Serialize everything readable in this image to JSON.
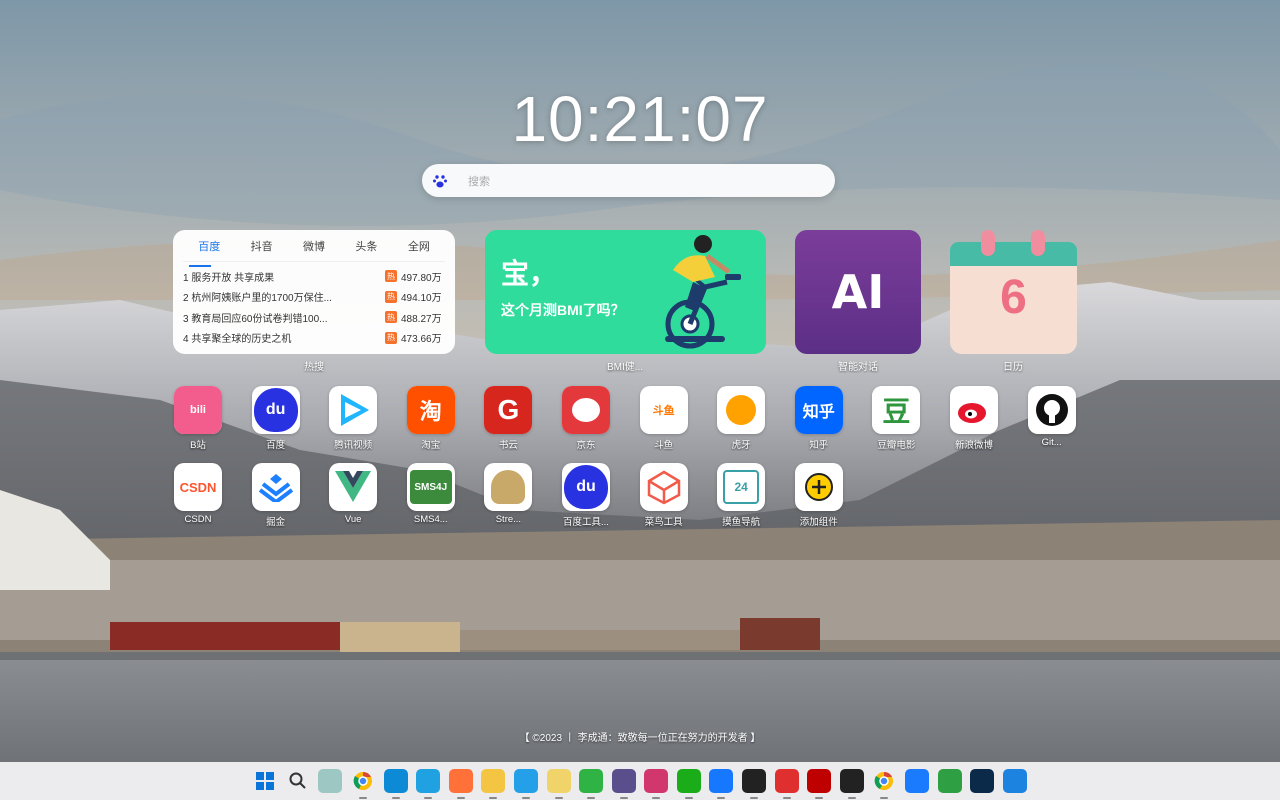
{
  "clock": {
    "time": "10:21:07"
  },
  "search": {
    "placeholder": "搜索",
    "engine_icon": "baidu-paw-icon"
  },
  "hot_widget": {
    "tabs": [
      "百度",
      "抖音",
      "微博",
      "头条",
      "全网"
    ],
    "active_tab": 0,
    "badge": "热",
    "items": [
      {
        "title": "1 服务开放 共享成果",
        "count": "497.80万"
      },
      {
        "title": "2 杭州阿姨账户里的1700万保住...",
        "count": "494.10万"
      },
      {
        "title": "3 教育局回应60份试卷判错100...",
        "count": "488.27万"
      },
      {
        "title": "4 共享聚全球的历史之机",
        "count": "473.66万"
      }
    ],
    "label": "热搜"
  },
  "bmi_widget": {
    "line1": "宝，",
    "line2": "这个月测BMI了吗？",
    "label": "BMI健..."
  },
  "ai_widget": {
    "text": "AI",
    "label": "智能对话"
  },
  "calendar_widget": {
    "day": "6",
    "label": "日历"
  },
  "apps_row1": [
    {
      "label": "B站",
      "icon": "bilibili-icon",
      "color": "#f25d8e"
    },
    {
      "label": "百度",
      "icon": "baidu-icon",
      "color": "#2932e1"
    },
    {
      "label": "腾讯视频",
      "icon": "tencent-video-icon",
      "color": "#1fb5ff"
    },
    {
      "label": "淘宝",
      "icon": "taobao-icon",
      "color": "#ff5000"
    },
    {
      "label": "书云",
      "icon": "g-logo-icon",
      "color": "#d7261e"
    },
    {
      "label": "京东",
      "icon": "jd-dog-icon",
      "color": "#e4393c"
    },
    {
      "label": "斗鱼",
      "icon": "douyu-icon",
      "color": "#ff7700"
    },
    {
      "label": "虎牙",
      "icon": "huya-icon",
      "color": "#ffa200"
    },
    {
      "label": "知乎",
      "icon": "zhihu-icon",
      "color": "#0066ff"
    },
    {
      "label": "豆瓣电影",
      "icon": "douban-icon",
      "color": "#2e963d"
    },
    {
      "label": "新浪微博",
      "icon": "weibo-icon",
      "color": "#e6162d"
    },
    {
      "label": "Git...",
      "icon": "github-icon",
      "color": "#000000"
    }
  ],
  "apps_row2": [
    {
      "label": "CSDN",
      "icon": "csdn-icon",
      "color": "#fc5531"
    },
    {
      "label": "掘金",
      "icon": "juejin-icon",
      "color": "#1e80ff"
    },
    {
      "label": "Vue",
      "icon": "vue-icon",
      "color": "#41b883"
    },
    {
      "label": "SMS4...",
      "icon": "sms4j-icon",
      "color": "#3c8a3c"
    },
    {
      "label": "Stre...",
      "icon": "streamline-icon",
      "color": "#c8a96a"
    },
    {
      "label": "百度工具...",
      "icon": "baidu-icon",
      "color": "#2932e1"
    },
    {
      "label": "菜鸟工具",
      "icon": "runoob-icon",
      "color": "#f25a4a"
    },
    {
      "label": "摸鱼导航",
      "icon": "moyu-calendar-icon",
      "color": "#3aa0a8"
    },
    {
      "label": "添加组件",
      "icon": "add-icon",
      "color": "#ffcc00"
    }
  ],
  "footer": {
    "text": "【 ©2023 丨 李成通：致敬每一位正在努力的开发者 】"
  },
  "taskbar": {
    "items": [
      "windows-start-icon",
      "search-icon",
      "copilot-icon",
      "chrome-icon",
      "edge-icon",
      "ie-icon",
      "firefox-icon",
      "file-explorer-icon",
      "vscode-icon",
      "idea-icon",
      "hbuilder-icon",
      "navicat-icon",
      "intellij-icon",
      "wechat-icon",
      "app-arrow-icon",
      "app-g-icon",
      "netease-music-icon",
      "filezilla-icon",
      "qq-icon",
      "chrome-icon",
      "feishu-icon",
      "thunder-icon",
      "photoshop-icon",
      "snipping-icon"
    ]
  }
}
